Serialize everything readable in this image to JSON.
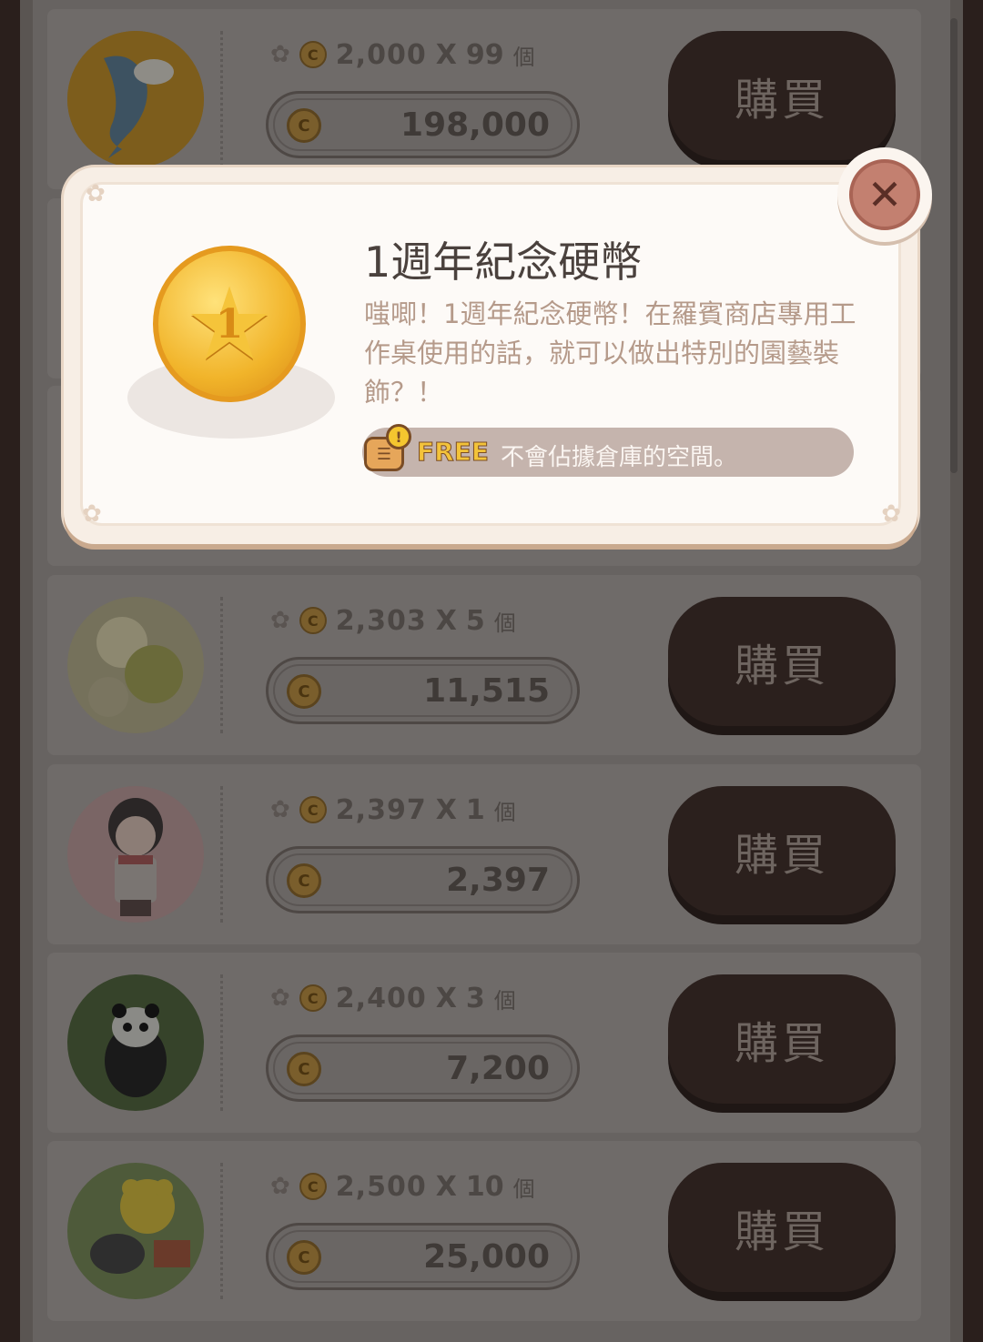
{
  "listings": [
    {
      "unit_price": "2,000",
      "x": "X",
      "qty": "99",
      "unit": "個",
      "total": "198,000",
      "buy_label": "購買",
      "avatar": "fish-avatar"
    },
    {
      "unit_price": "2,303",
      "x": "X",
      "qty": "5",
      "unit": "個",
      "total": "11,515",
      "buy_label": "購買",
      "avatar": "flower-avatar"
    },
    {
      "unit_price": "2,397",
      "x": "X",
      "qty": "1",
      "unit": "個",
      "total": "2,397",
      "buy_label": "購買",
      "avatar": "girl-avatar"
    },
    {
      "unit_price": "2,400",
      "x": "X",
      "qty": "3",
      "unit": "個",
      "total": "7,200",
      "buy_label": "購買",
      "avatar": "panda-avatar"
    },
    {
      "unit_price": "2,500",
      "x": "X",
      "qty": "10",
      "unit": "個",
      "total": "25,000",
      "buy_label": "購買",
      "avatar": "bear-avatar"
    }
  ],
  "popup": {
    "title": "1週年紀念硬幣",
    "description": "嗤唧！1週年紀念硬幣！在羅賓商店專用工作桌使用的話，就可以做出特別的園藝裝飾？！",
    "free_label": "FREE",
    "free_text": "不會佔據倉庫的空間。",
    "close_icon": "close-icon"
  },
  "colors": {
    "overlay": "#676361",
    "buy_button": "#2b201d",
    "popup_bg": "#fdfaf7",
    "close_button": "#c38070",
    "coin": "#f1b42a"
  }
}
